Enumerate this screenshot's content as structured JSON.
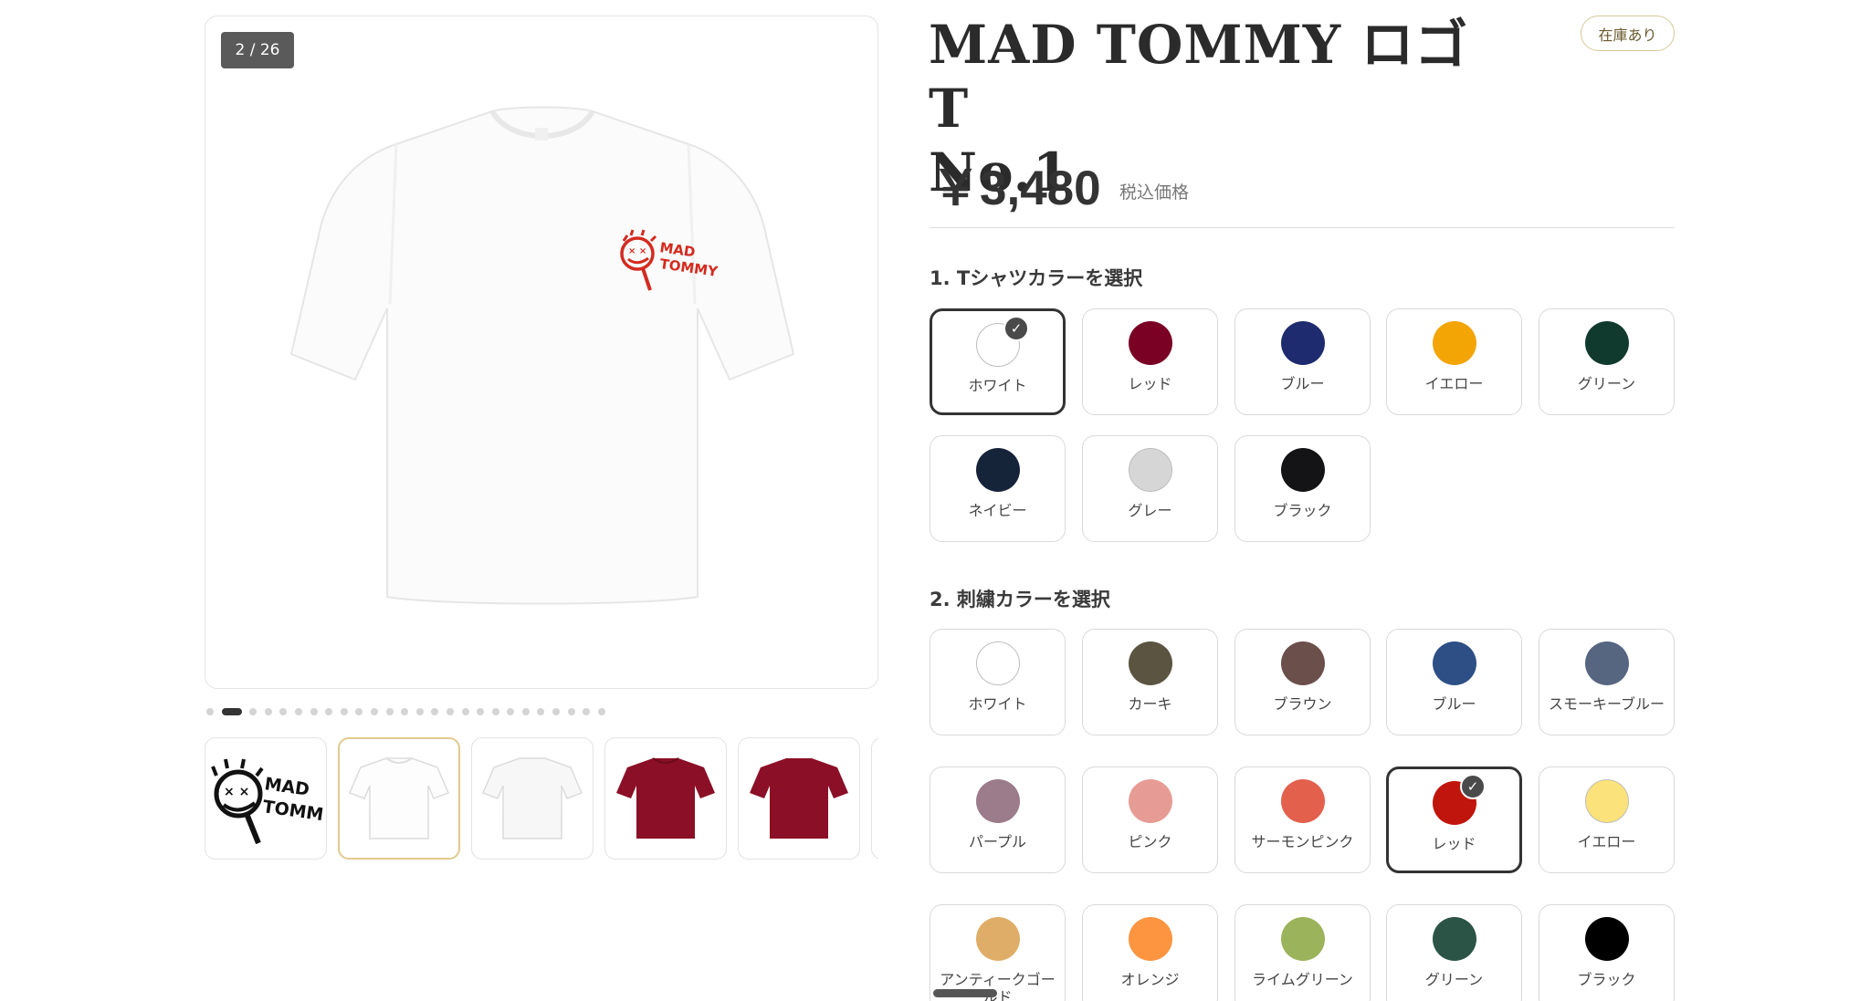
{
  "gallery": {
    "counter": "2 / 26",
    "dot_count": 26,
    "active_dot": 1,
    "main_shirt_color": "#ffffff",
    "logo": {
      "line1": "MAD",
      "line2": "TOMMY",
      "color": "#d42a1f"
    },
    "thumbnails": [
      {
        "kind": "logo",
        "color": "#111111"
      },
      {
        "kind": "shirt",
        "color": "#ffffff"
      },
      {
        "kind": "shirt-back",
        "color": "#ffffff"
      },
      {
        "kind": "shirt",
        "color": "#8b0f26"
      },
      {
        "kind": "shirt",
        "color": "#8b0f26"
      },
      {
        "kind": "partial",
        "color": "#ffffff"
      }
    ]
  },
  "product": {
    "title_line1": "MAD TOMMY ロゴT",
    "title_line2": "No.1",
    "stock_badge": "在庫あり",
    "price": "￥3,480",
    "tax_note": "税込価格"
  },
  "shirt_colors": {
    "label": "1. Tシャツカラーを選択",
    "options": [
      {
        "name": "ホワイト",
        "color": "#ffffff",
        "selected": true
      },
      {
        "name": "レッド",
        "color": "#7a0024",
        "selected": false
      },
      {
        "name": "ブルー",
        "color": "#1f2b6f",
        "selected": false
      },
      {
        "name": "イエロー",
        "color": "#f2a505",
        "selected": false
      },
      {
        "name": "グリーン",
        "color": "#113a2e",
        "selected": false
      },
      {
        "name": "ネイビー",
        "color": "#16243a",
        "selected": false
      },
      {
        "name": "グレー",
        "color": "#d6d6d6",
        "selected": false
      },
      {
        "name": "ブラック",
        "color": "#141416",
        "selected": false
      }
    ]
  },
  "embroidery_colors": {
    "label": "2. 刺繍カラーを選択",
    "options": [
      {
        "name": "ホワイト",
        "color": "#ffffff",
        "selected": false
      },
      {
        "name": "カーキ",
        "color": "#5b5440",
        "selected": false
      },
      {
        "name": "ブラウン",
        "color": "#6b4f4b",
        "selected": false
      },
      {
        "name": "ブルー",
        "color": "#2d4f86",
        "selected": false
      },
      {
        "name": "スモーキーブルー",
        "color": "#566580",
        "selected": false
      },
      {
        "name": "パープル",
        "color": "#9c7b8a",
        "selected": false
      },
      {
        "name": "ピンク",
        "color": "#e69c95",
        "selected": false
      },
      {
        "name": "サーモンピンク",
        "color": "#e3604d",
        "selected": false
      },
      {
        "name": "レッド",
        "color": "#c0150c",
        "selected": true
      },
      {
        "name": "イエロー",
        "color": "#fbe27a",
        "selected": false
      },
      {
        "name": "アンティークゴールド",
        "color": "#e0ad68",
        "selected": false
      },
      {
        "name": "オレンジ",
        "color": "#fd9440",
        "selected": false
      },
      {
        "name": "ライムグリーン",
        "color": "#9bb35a",
        "selected": false
      },
      {
        "name": "グリーン",
        "color": "#2b5446",
        "selected": false
      },
      {
        "name": "ブラック",
        "color": "#000000",
        "selected": false
      }
    ]
  }
}
